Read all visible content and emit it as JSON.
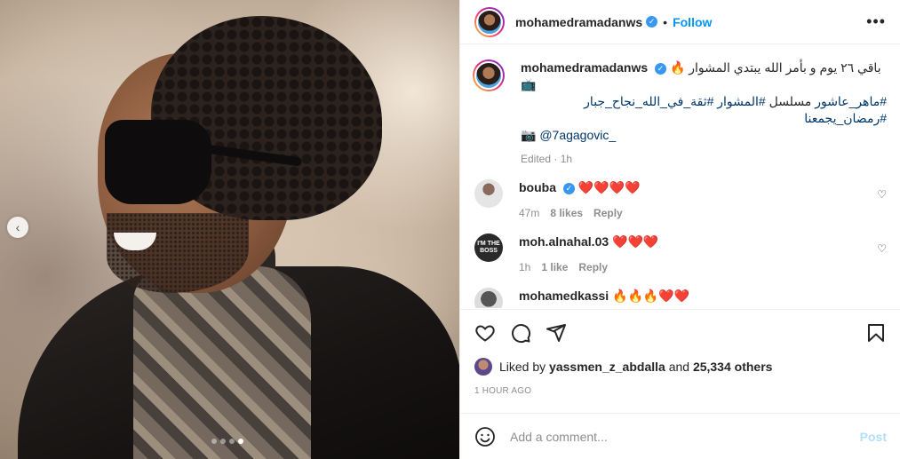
{
  "header": {
    "username": "mohamedramadanws",
    "separator": "•",
    "follow_label": "Follow",
    "more_label": "•••"
  },
  "caption": {
    "username": "mohamedramadanws",
    "line1": "باقي ٢٦ يوم و بأمر الله يبتدي المشوار 🔥📺",
    "line2_text": "مسلسل",
    "line2_tags": [
      "#ماهر_عاشور",
      "#المشوار",
      "#ثقة_في_الله_نجاح_جبار",
      "#رمضان_يجمعنا"
    ],
    "line3_camera": "📷",
    "line3_mention": "@7agagovic_",
    "meta": "Edited · 1h"
  },
  "comments": [
    {
      "username": "bouba",
      "verified": true,
      "text": "❤️❤️❤️❤️",
      "time": "47m",
      "likes": "8 likes",
      "reply": "Reply"
    },
    {
      "username": "moh.alnahal.03",
      "verified": false,
      "avatar_text": "I'M THE BOSS",
      "text": "❤️❤️❤️",
      "time": "1h",
      "likes": "1 like",
      "reply": "Reply"
    },
    {
      "username": "mohamedkassi",
      "verified": false,
      "text": "🔥🔥🔥❤️❤️"
    }
  ],
  "actions": {
    "icons": [
      "heart-icon",
      "comment-icon",
      "share-icon",
      "bookmark-icon"
    ]
  },
  "likes": {
    "prefix": "Liked by",
    "user": "yassmen_z_abdalla",
    "middle": "and",
    "others": "25,334 others"
  },
  "timestamp": "1 HOUR AGO",
  "comment_box": {
    "placeholder": "Add a comment...",
    "post_label": "Post"
  },
  "carousel": {
    "dot_count": 4,
    "active_index": 3,
    "prev_label": "‹"
  },
  "colors": {
    "accent": "#0095f6",
    "verified": "#3897f0",
    "hashtag": "#00376b",
    "muted": "#8e8e8e",
    "post_disabled": "#b2dffc"
  }
}
